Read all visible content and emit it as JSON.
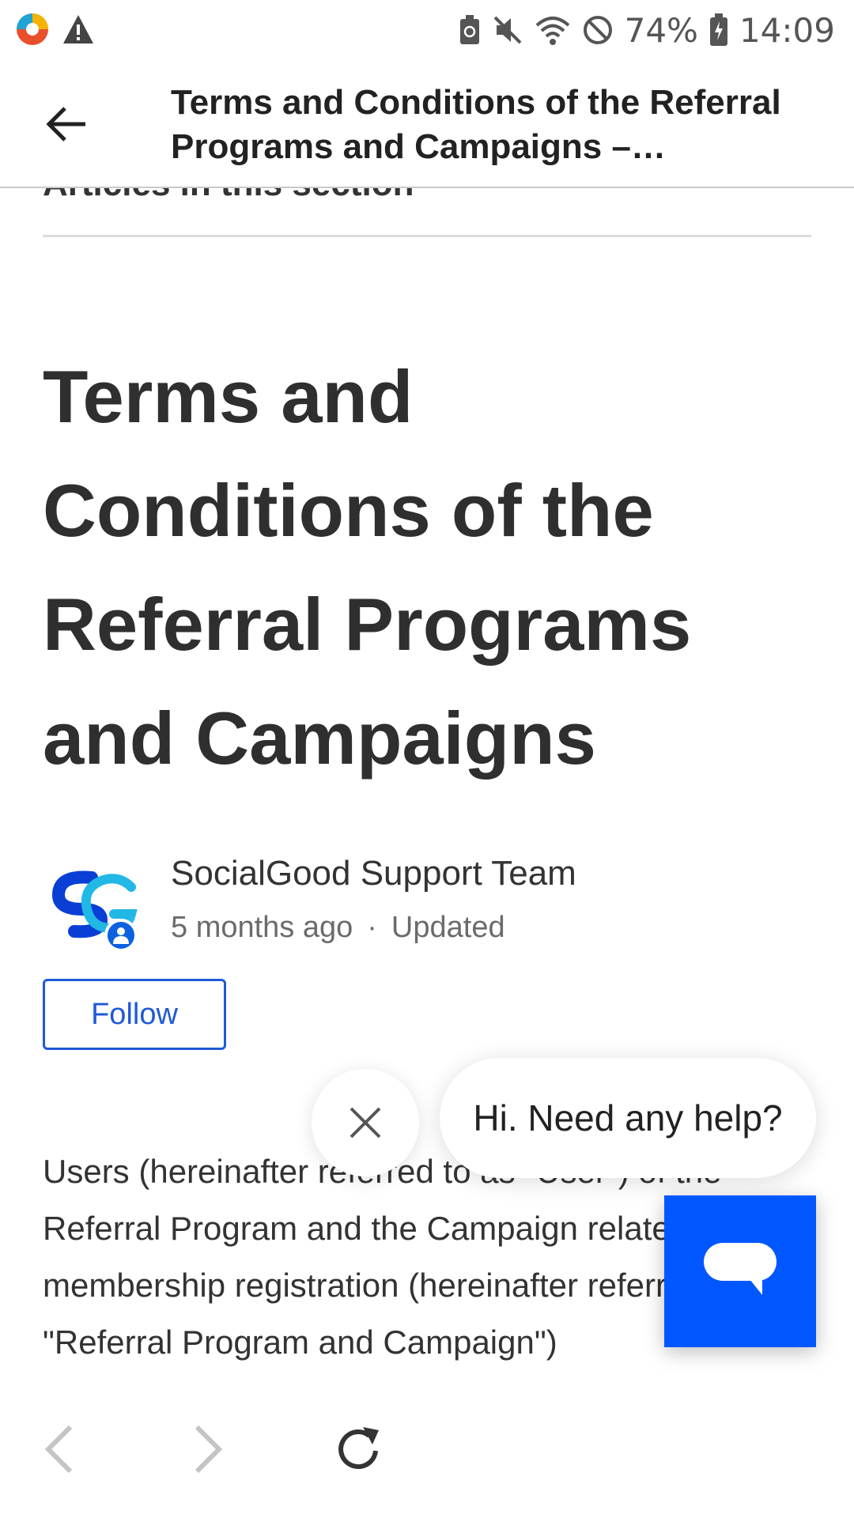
{
  "status_bar": {
    "battery_percent": "74%",
    "time": "14:09",
    "left_icons": [
      "app-logo-icon",
      "warning-icon"
    ],
    "right_icons": [
      "battery-saver-icon",
      "mute-icon",
      "wifi-icon",
      "do-not-disturb-icon",
      "battery-icon"
    ]
  },
  "app_bar": {
    "title": "Terms and Conditions of the Referral Programs and Campaigns – SocialGood Support"
  },
  "section": {
    "label": "Articles in this section"
  },
  "article": {
    "title": "Terms and Conditions of the Referral Programs and Campaigns",
    "author": "SocialGood Support Team",
    "posted": "5 months ago",
    "separator": "·",
    "updated": "Updated",
    "follow_label": "Follow",
    "body": "Users (hereinafter referred to as \"User\") of the Referral Program and the Campaign related to new membership registration (hereinafter referred to as \"Referral Program and Campaign\")"
  },
  "chat": {
    "prompt": "Hi. Need any help?"
  },
  "colors": {
    "accent": "#0057ff",
    "follow": "#1f5ad6",
    "text": "#333333"
  }
}
